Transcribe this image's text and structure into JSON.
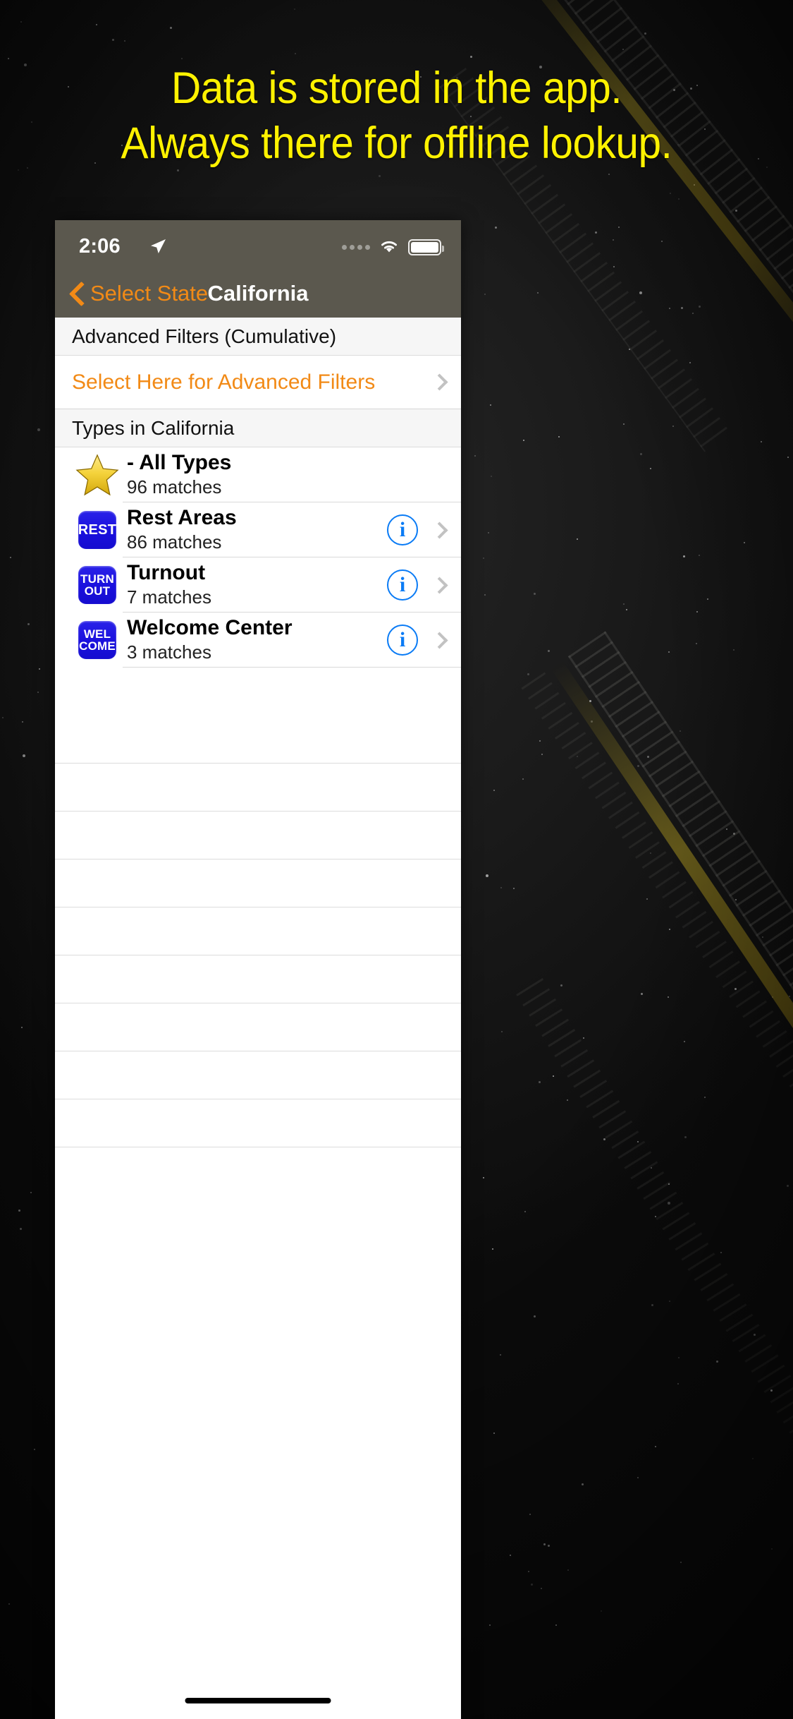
{
  "headline": {
    "line1": "Data is stored in the app.",
    "line2": "Always there for offline lookup.",
    "color": "#fff200"
  },
  "phone": {
    "status_bar": {
      "time": "2:06",
      "location_icon": "location-arrow-icon",
      "signal_icon": "signal-dots-icon",
      "wifi_icon": "wifi-icon",
      "battery_icon": "battery-full-icon",
      "background_color": "#5b584e"
    },
    "nav_bar": {
      "back_label": "Select State",
      "back_icon": "chevron-left-icon",
      "title": "California",
      "accent_color": "#f28a16"
    },
    "sections": [
      {
        "header": "Advanced Filters (Cumulative)",
        "rows": [
          {
            "label": "Select Here for Advanced Filters",
            "accessory": "chevron-right-icon"
          }
        ]
      },
      {
        "header": "Types in California",
        "types": [
          {
            "icon": "gold-star-icon",
            "badge_lines": [],
            "title": "- All Types",
            "subtitle": "96 matches",
            "has_info": false,
            "has_chevron": false
          },
          {
            "icon": "rest-badge-icon",
            "badge_lines": [
              "REST"
            ],
            "title": "Rest Areas",
            "subtitle": "86 matches",
            "has_info": true,
            "has_chevron": true,
            "info_label": "i"
          },
          {
            "icon": "turnout-badge-icon",
            "badge_lines": [
              "TURN",
              "OUT"
            ],
            "title": "Turnout",
            "subtitle": "7 matches",
            "has_info": true,
            "has_chevron": true,
            "info_label": "i"
          },
          {
            "icon": "welcome-badge-icon",
            "badge_lines": [
              "WEL",
              "COME"
            ],
            "title": "Welcome Center",
            "subtitle": "3 matches",
            "has_info": true,
            "has_chevron": true,
            "info_label": "i"
          }
        ]
      }
    ],
    "badge_color": "#1a10dd",
    "info_color": "#0a7bf5"
  }
}
